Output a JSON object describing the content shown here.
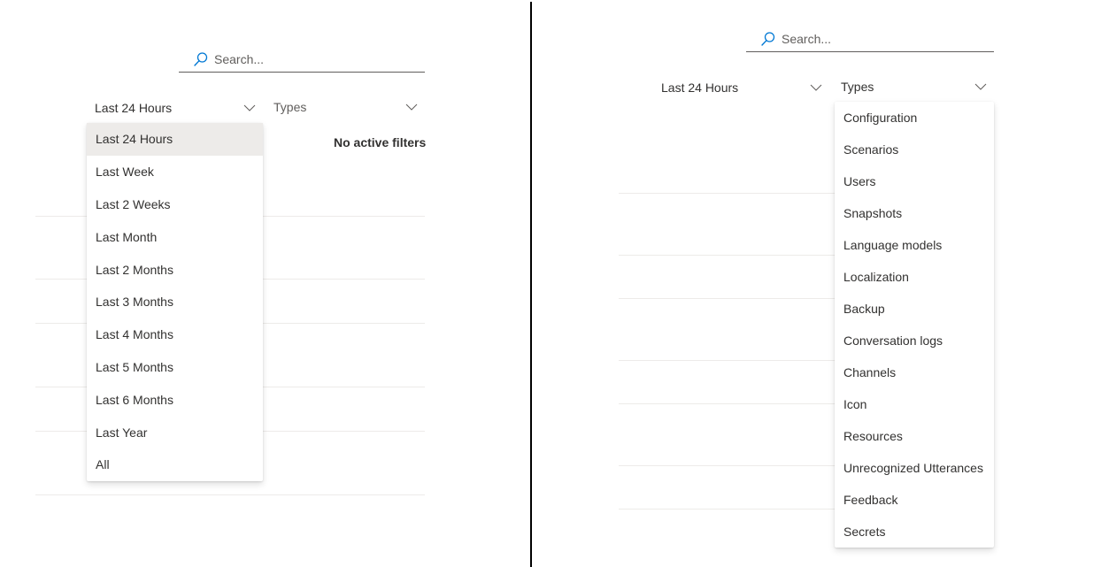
{
  "left_panel": {
    "search": {
      "placeholder": "Search...",
      "value": ""
    },
    "time_filter": {
      "selected": "Last 24 Hours",
      "is_open": true,
      "options": [
        "Last 24 Hours",
        "Last Week",
        "Last 2 Weeks",
        "Last Month",
        "Last 2 Months",
        "Last 3 Months",
        "Last 4 Months",
        "Last 5 Months",
        "Last 6 Months",
        "Last Year",
        "All"
      ]
    },
    "types_filter": {
      "placeholder": "Types",
      "is_open": false
    },
    "status_text": "No active filters"
  },
  "right_panel": {
    "search": {
      "placeholder": "Search...",
      "value": ""
    },
    "time_filter": {
      "selected": "Last 24 Hours",
      "is_open": false
    },
    "types_filter": {
      "placeholder": "Types",
      "is_open": true,
      "options": [
        "Configuration",
        "Scenarios",
        "Users",
        "Snapshots",
        "Language models",
        "Localization",
        "Backup",
        "Conversation logs",
        "Channels",
        "Icon",
        "Resources",
        "Unrecognized Utterances",
        "Feedback",
        "Secrets"
      ]
    }
  },
  "icons": {
    "search": "search-icon",
    "chevron": "chevron-down-icon"
  },
  "colors": {
    "accent": "#0078d4",
    "text": "#323130",
    "placeholder": "#605e5c",
    "selected_bg": "#edebe9",
    "divider": "#000000"
  }
}
